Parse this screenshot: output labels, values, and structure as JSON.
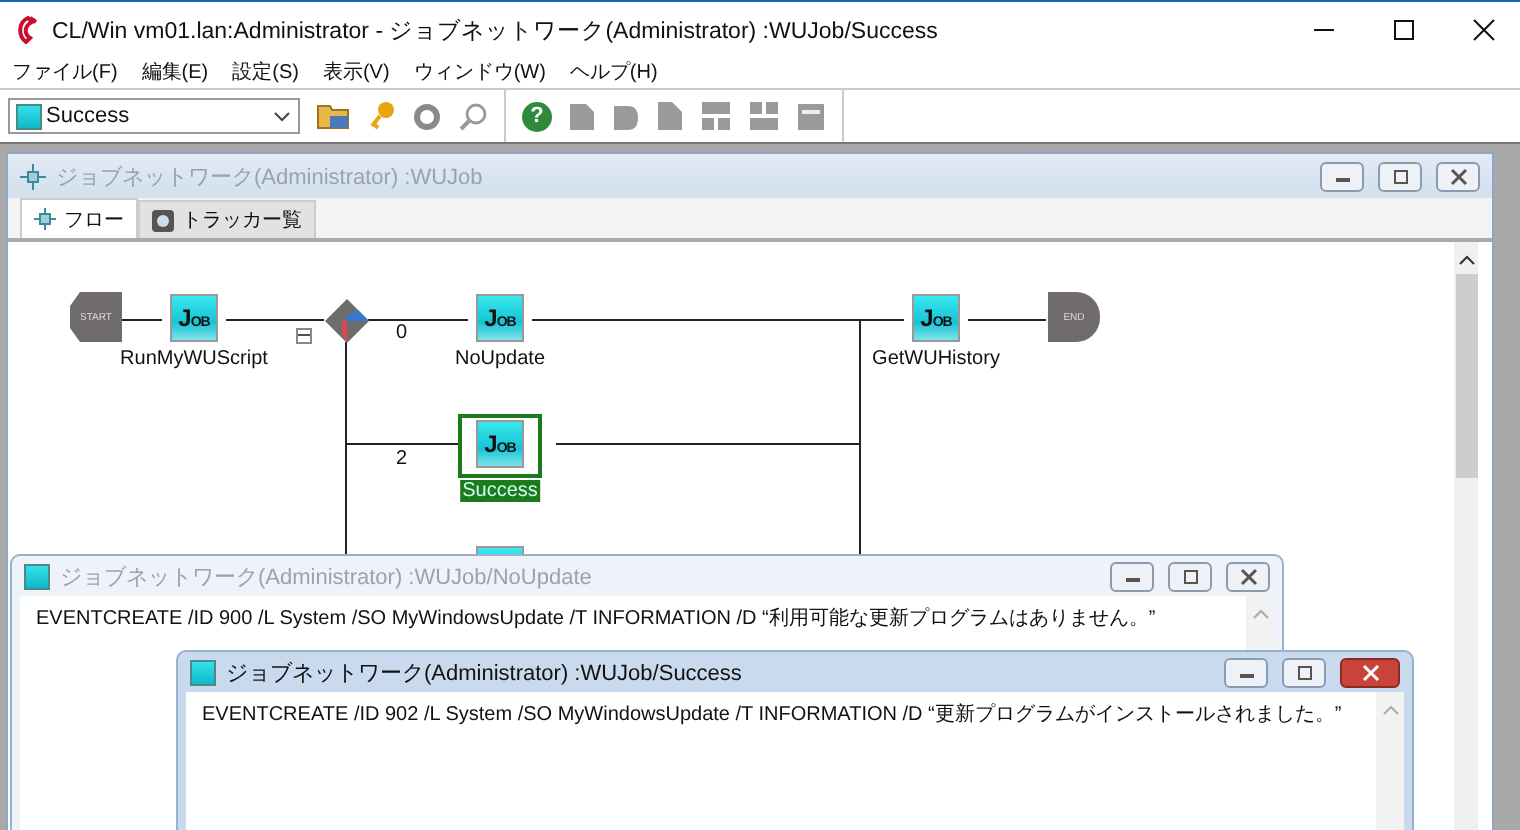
{
  "window": {
    "title": "CL/Win vm01.lan:Administrator - ジョブネットワーク(Administrator) :WUJob/Success"
  },
  "menu": [
    "ファイル(F)",
    "編集(E)",
    "設定(S)",
    "表示(V)",
    "ウィンドウ(W)",
    "ヘルプ(H)"
  ],
  "toolbar": {
    "job_selector": {
      "value": "Success"
    },
    "help_label": "?"
  },
  "network_window": {
    "title": "ジョブネットワーク(Administrator) :WUJob",
    "active": false,
    "tabs": [
      {
        "label": "フロー",
        "selected": true
      },
      {
        "label": "トラッカー覧",
        "selected": false
      }
    ],
    "nodes": [
      {
        "kind": "start",
        "text": "START"
      },
      {
        "kind": "job",
        "badge": "JOB",
        "label": "RunMyWUScript",
        "selected": false
      },
      {
        "kind": "branch"
      },
      {
        "kind": "job",
        "badge": "JOB",
        "label": "NoUpdate",
        "selected": false
      },
      {
        "kind": "job",
        "badge": "JOB",
        "label": "GetWUHistory",
        "selected": false
      },
      {
        "kind": "end",
        "text": "END"
      },
      {
        "kind": "job",
        "badge": "JOB",
        "label": "Success",
        "selected": true
      },
      {
        "kind": "job",
        "selected": false
      }
    ],
    "branch_labels": [
      "0",
      "2"
    ]
  },
  "detail_windows": [
    {
      "title": "ジョブネットワーク(Administrator) :WUJob/NoUpdate",
      "active": false,
      "command": "EVENTCREATE /ID 900 /L System /SO MyWindowsUpdate /T INFORMATION /D “利用可能な更新プログラムはありません。”"
    },
    {
      "title": "ジョブネットワーク(Administrator) :WUJob/Success",
      "active": true,
      "command": "EVENTCREATE /ID 902 /L System /SO MyWindowsUpdate /T INFORMATION /D “更新プログラムがインストールされました。”"
    }
  ]
}
